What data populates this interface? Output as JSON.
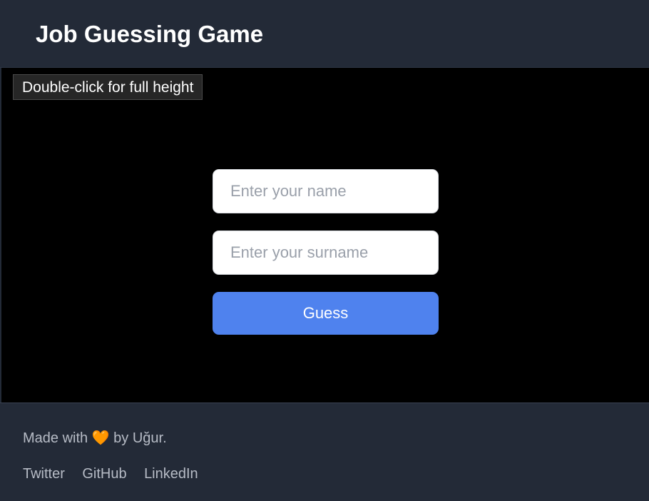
{
  "header": {
    "title": "Job Guessing Game"
  },
  "stage": {
    "hint": "Double-click for full height"
  },
  "form": {
    "name_placeholder": "Enter your name",
    "name_value": "",
    "surname_placeholder": "Enter your surname",
    "surname_value": "",
    "guess_label": "Guess",
    "accent_color": "#4f82ee"
  },
  "footer": {
    "made_with_prefix": "Made with ",
    "heart_icon": "🧡",
    "made_with_suffix": " by Uğur.",
    "links": [
      "Twitter",
      "GitHub",
      "LinkedIn"
    ]
  }
}
